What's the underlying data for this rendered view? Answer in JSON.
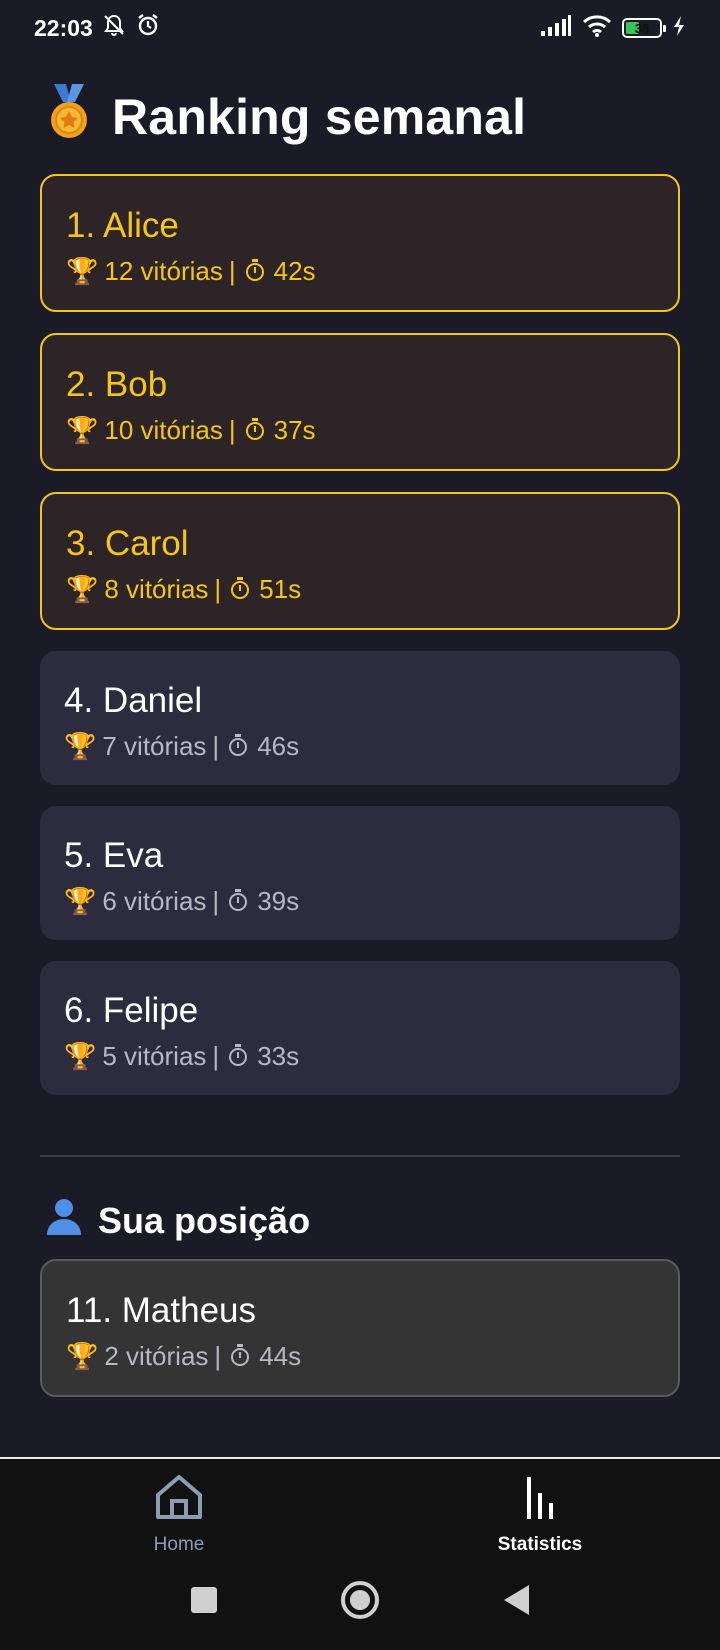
{
  "status_bar": {
    "time": "22:03",
    "battery": "38",
    "icons": [
      "mute-notifications-icon",
      "alarm-icon",
      "signal-icon",
      "wifi-icon",
      "battery-icon",
      "charging-icon"
    ]
  },
  "header": {
    "icon": "medal",
    "title": "Ranking semanal"
  },
  "ranking": [
    {
      "name": "1. Alice",
      "wins": "12 vitórias",
      "time": "42s",
      "highlight": true
    },
    {
      "name": "2. Bob",
      "wins": "10 vitórias",
      "time": "37s",
      "highlight": true
    },
    {
      "name": "3. Carol",
      "wins": "8 vitórias",
      "time": "51s",
      "highlight": true
    },
    {
      "name": "4. Daniel",
      "wins": "7 vitórias",
      "time": "46s",
      "highlight": false
    },
    {
      "name": "5. Eva",
      "wins": "6 vitórias",
      "time": "39s",
      "highlight": false
    },
    {
      "name": "6. Felipe",
      "wins": "5 vitórias",
      "time": "33s",
      "highlight": false
    }
  ],
  "my_position": {
    "title": "Sua posição",
    "name": "11. Matheus",
    "wins": "2 vitórias",
    "time": "44s"
  },
  "separator": "|",
  "bottom_nav": {
    "items": [
      {
        "label": "Home",
        "icon": "home-icon",
        "active": false
      },
      {
        "label": "Statistics",
        "icon": "bar-chart-icon",
        "active": true
      }
    ]
  },
  "colors": {
    "background": "#1b1b27",
    "gold": "#f5c518",
    "card": "#2c2c3e",
    "card_top": "#2c2426"
  }
}
